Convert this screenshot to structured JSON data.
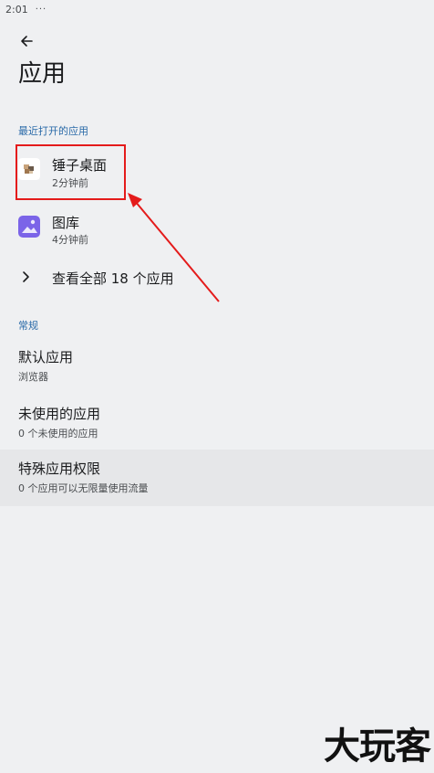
{
  "status_bar": {
    "time": "2:01",
    "dots": "···"
  },
  "page": {
    "title": "应用"
  },
  "recent": {
    "header": "最近打开的应用",
    "apps": [
      {
        "name": "锤子桌面",
        "time": "2分钟前",
        "icon": "launcher-icon"
      },
      {
        "name": "图库",
        "time": "4分钟前",
        "icon": "gallery-icon"
      }
    ],
    "see_all": "查看全部 18 个应用"
  },
  "general": {
    "header": "常规",
    "items": [
      {
        "title": "默认应用",
        "subtitle": "浏览器"
      },
      {
        "title": "未使用的应用",
        "subtitle": "0 个未使用的应用"
      },
      {
        "title": "特殊应用权限",
        "subtitle": "0 个应用可以无限量使用流量"
      }
    ]
  },
  "annotation": {
    "color": "#e41b1b"
  },
  "watermark": "大玩客",
  "colors": {
    "background": "#eff0f2",
    "accent": "#2a6aa8",
    "gallery": "#7b64e8"
  }
}
